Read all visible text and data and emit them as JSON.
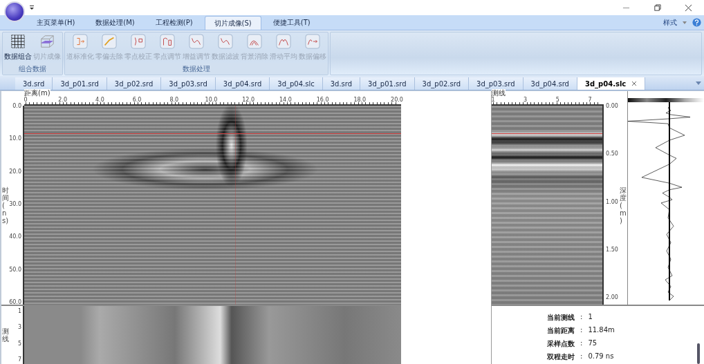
{
  "menu_tabs": [
    {
      "label": "主页菜单(H)",
      "selected": false
    },
    {
      "label": "数据处理(M)",
      "selected": false
    },
    {
      "label": "工程检测(P)",
      "selected": false
    },
    {
      "label": "切片成像(S)",
      "selected": true
    },
    {
      "label": "便捷工具(T)",
      "selected": false
    }
  ],
  "style_menu": "样式",
  "ribbon_groups": [
    {
      "label": "组合数据",
      "buttons": [
        {
          "label": "数据组合",
          "disabled": false,
          "kind": "grid"
        },
        {
          "label": "切片成像",
          "disabled": true,
          "kind": "cube"
        }
      ]
    },
    {
      "label": "数据处理",
      "buttons": [
        {
          "label": "道标准化",
          "disabled": true,
          "kind": "arrow"
        },
        {
          "label": "零偏去除",
          "disabled": true,
          "kind": "ramp"
        },
        {
          "label": "零点校正",
          "disabled": true,
          "kind": "dot"
        },
        {
          "label": "零点调节",
          "disabled": true,
          "kind": "adjust"
        },
        {
          "label": "增益调节",
          "disabled": true,
          "kind": "wave"
        },
        {
          "label": "数据滤波",
          "disabled": true,
          "kind": "wave"
        },
        {
          "label": "背景消除",
          "disabled": true,
          "kind": "hill"
        },
        {
          "label": "滑动平均",
          "disabled": true,
          "kind": "peak"
        },
        {
          "label": "数据偏移",
          "disabled": true,
          "kind": "shift"
        }
      ]
    }
  ],
  "doc_tabs": [
    {
      "label": "3d.srd",
      "selected": false
    },
    {
      "label": "3d_p01.srd",
      "selected": false
    },
    {
      "label": "3d_p02.srd",
      "selected": false
    },
    {
      "label": "3d_p03.srd",
      "selected": false
    },
    {
      "label": "3d_p04.srd",
      "selected": false
    },
    {
      "label": "3d_p04.slc",
      "selected": false
    },
    {
      "label": "3d.srd",
      "selected": false
    },
    {
      "label": "3d_p01.srd",
      "selected": false
    },
    {
      "label": "3d_p02.srd",
      "selected": false
    },
    {
      "label": "3d_p03.srd",
      "selected": false
    },
    {
      "label": "3d_p04.srd",
      "selected": false
    },
    {
      "label": "3d_p04.slc",
      "selected": true
    }
  ],
  "profile": {
    "x_label": "距离(m)",
    "x_ticks": [
      "0",
      "2.0",
      "4.0",
      "6.0",
      "8.0",
      "10.0",
      "12.0",
      "14.0",
      "16.0",
      "18.0",
      "20.0"
    ],
    "y_label": "时间(ns)",
    "y_ticks": [
      "0.0",
      "10.0",
      "20.0",
      "30.0",
      "40.0",
      "50.0",
      "60.0"
    ]
  },
  "plan": {
    "y_label": "测线",
    "y_ticks": [
      "1",
      "3",
      "5",
      "7"
    ]
  },
  "slice": {
    "x_label": "测线",
    "x_ticks": [
      "1",
      "3",
      "5",
      "7"
    ],
    "y_label": "深度(m)",
    "y_ticks": [
      "0.00",
      "0.50",
      "1.00",
      "1.50",
      "2.00"
    ]
  },
  "info": [
    {
      "label": "当前测线",
      "separator": ":",
      "value": "1"
    },
    {
      "label": "当前距离",
      "separator": ":",
      "value": "11.84m"
    },
    {
      "label": "采样点数",
      "separator": ":",
      "value": "75"
    },
    {
      "label": "双程走时",
      "separator": ":",
      "value": "0.79 ns"
    }
  ]
}
